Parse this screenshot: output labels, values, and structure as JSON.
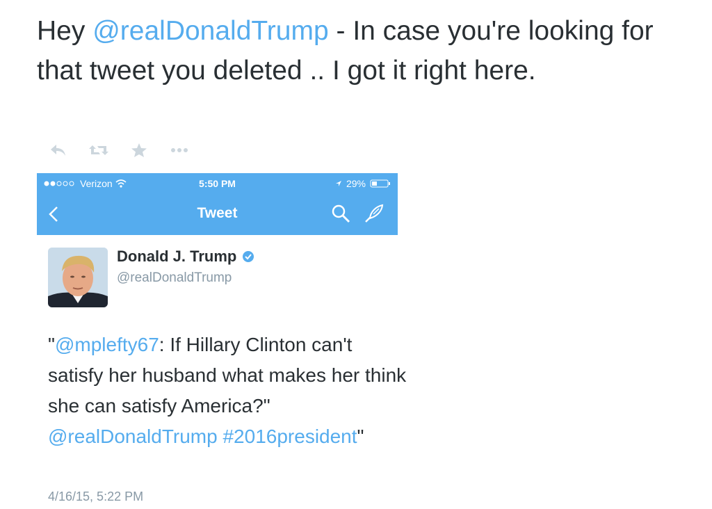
{
  "outer_tweet": {
    "text_prefix": "Hey ",
    "mention": "@realDonaldTrump",
    "text_suffix": " - In case you're looking for that tweet you deleted .. I got it right here."
  },
  "actions": {
    "reply_icon": "reply-icon",
    "retweet_icon": "retweet-icon",
    "favorite_icon": "star-icon",
    "more_icon": "more-dots-icon"
  },
  "phone": {
    "carrier": "Verizon",
    "time": "5:50 PM",
    "battery": "29%",
    "nav_title": "Tweet",
    "accent_color": "#55acee"
  },
  "tweet": {
    "author_name": "Donald J. Trump",
    "author_handle": "@realDonaldTrump",
    "quote_open": "\"",
    "quoted_mention": "@mplefty67",
    "body_1": ":  If Hillary Clinton can't satisfy her husband what makes her think she can satisfy America?\" ",
    "mention_2": "@realDonaldTrump",
    "hashtag": "#2016president",
    "quote_close": "\"",
    "timestamp": "4/16/15, 5:22 PM"
  }
}
